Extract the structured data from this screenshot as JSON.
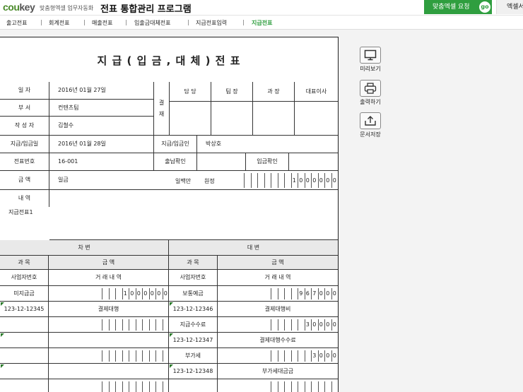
{
  "header": {
    "logo_left": "cou",
    "logo_right": "key",
    "tagline": "맞춤형엑셀 업무자동화",
    "app_title": "전표 통합관리 프로그램",
    "request_button": "맞춤엑셀 요청",
    "go_badge": "go",
    "second_button": "엑셀서"
  },
  "nav": {
    "tabs": [
      {
        "label": "출고전표"
      },
      {
        "label": "회계전표"
      },
      {
        "label": "매출전표"
      },
      {
        "label": "입출금대체전표"
      },
      {
        "label": "지급전표입력"
      },
      {
        "label": "지급전표"
      }
    ],
    "active_index": 5,
    "active_color": "#2f9e3f"
  },
  "doc": {
    "title": "지 급 ( 입 금 , 대 체 ) 전 표",
    "labels": {
      "date": "일        자",
      "dept": "부        서",
      "writer": "작  성  자",
      "pay_date": "지급/입금일",
      "slip_no": "전표번호",
      "approval": "결\n\n재",
      "approvers": [
        "담 당",
        "팀 장",
        "과 장",
        "대표이사"
      ],
      "payee": "지급/입금인",
      "out_confirm": "출납확인",
      "in_confirm": "입금확인",
      "amount": "금        액",
      "memo": "내        역",
      "unit_hint": "일백만",
      "won": "원정"
    },
    "values": {
      "date": "2016년 01월 27일",
      "dept": "컨텐츠팀",
      "writer": "김철수",
      "pay_date": "2016년 01월 28일",
      "slip_no": "16-001",
      "payee": "박상호",
      "amount_text": "일금",
      "amount_digits": "1000000",
      "memo": "지급전표1"
    }
  },
  "ledger": {
    "debit_title": "차                변",
    "credit_title": "대                변",
    "col_account": "과        목",
    "col_amount": "금        액",
    "col_bizno": "사업자번호",
    "col_detail": "거     래     내     역",
    "debit": [
      {
        "account": "미지급금",
        "digits": "1000000"
      },
      {
        "bizno": "123-12-12345",
        "detail": "결제대행"
      },
      {
        "account": "",
        "digits": ""
      },
      {
        "bizno": "",
        "detail": ""
      },
      {
        "account": "",
        "digits": ""
      },
      {
        "bizno": "",
        "detail": ""
      },
      {
        "account": "",
        "digits": ""
      }
    ],
    "credit": [
      {
        "account": "보통예금",
        "digits": "967000"
      },
      {
        "bizno": "123-12-12346",
        "detail": "결제대행비"
      },
      {
        "account": "지급수수료",
        "digits": "30000"
      },
      {
        "bizno": "123-12-12347",
        "detail": "결제대행수수료"
      },
      {
        "account": "부가세",
        "digits": "3000"
      },
      {
        "bizno": "123-12-12348",
        "detail": "부가세대금금"
      },
      {
        "account": "",
        "digits": ""
      }
    ]
  },
  "side": {
    "preview": "미리보기",
    "print": "출력하기",
    "save": "문서저장"
  }
}
